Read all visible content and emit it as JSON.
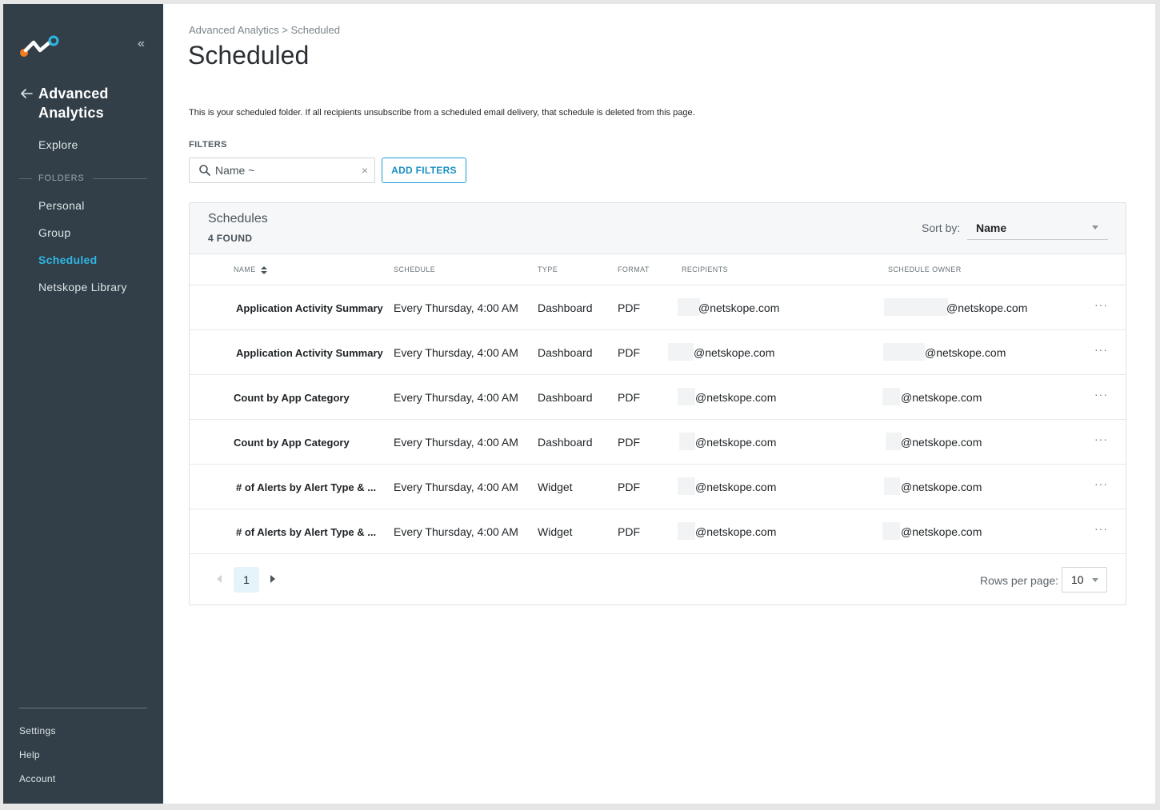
{
  "sidebar": {
    "app_title": "Advanced Analytics",
    "explore": "Explore",
    "folders_label": "FOLDERS",
    "items": [
      {
        "label": "Personal"
      },
      {
        "label": "Group"
      },
      {
        "label": "Scheduled"
      },
      {
        "label": "Netskope Library"
      }
    ],
    "bottom": [
      {
        "label": "Settings"
      },
      {
        "label": "Help"
      },
      {
        "label": "Account"
      }
    ],
    "colors": {
      "background": "#323f48",
      "active": "#2fb6e4"
    }
  },
  "main": {
    "breadcrumb": "Advanced Analytics > Scheduled",
    "title": "Scheduled",
    "intro": "This is your scheduled folder. If all recipients unsubscribe from a scheduled email delivery, that schedule is deleted from this page.",
    "filters_label": "FILTERS",
    "search": {
      "value": "Name ~"
    },
    "add_filters": "ADD FILTERS"
  },
  "panel": {
    "title": "Schedules",
    "count": "4 FOUND",
    "sort_label": "Sort by:",
    "sort_value": "Name",
    "columns": [
      "NAME",
      "SCHEDULE",
      "TYPE",
      "FORMAT",
      "RECIPIENTS",
      "SCHEDULE OWNER"
    ],
    "rows": [
      {
        "name": "Application Activity Summary",
        "schedule": "Every Thursday, 4:00 AM",
        "type": "Dashboard",
        "format": "PDF",
        "recipients": "@netskope.com",
        "owner": "@netskope.com"
      },
      {
        "name": "Application Activity Summary",
        "schedule": "Every Thursday, 4:00 AM",
        "type": "Dashboard",
        "format": "PDF",
        "recipients": "@netskope.com",
        "owner": "@netskope.com"
      },
      {
        "name": "Count by App Category",
        "schedule": "Every Thursday, 4:00 AM",
        "type": "Dashboard",
        "format": "PDF",
        "recipients": "@netskope.com",
        "owner": "@netskope.com"
      },
      {
        "name": "Count by App Category",
        "schedule": "Every Thursday, 4:00 AM",
        "type": "Dashboard",
        "format": "PDF",
        "recipients": "@netskope.com",
        "owner": "@netskope.com"
      },
      {
        "name": "# of Alerts by Alert Type & ...",
        "schedule": "Every Thursday, 4:00 AM",
        "type": "Widget",
        "format": "PDF",
        "recipients": "@netskope.com",
        "owner": "@netskope.com"
      },
      {
        "name": "# of Alerts by Alert Type & ...",
        "schedule": "Every Thursday, 4:00 AM",
        "type": "Widget",
        "format": "PDF",
        "recipients": "@netskope.com",
        "owner": "@netskope.com"
      }
    ],
    "more_label": "···",
    "pagination": {
      "current_page": "1",
      "rows_label": "Rows per page:",
      "rows_value": "10"
    }
  }
}
